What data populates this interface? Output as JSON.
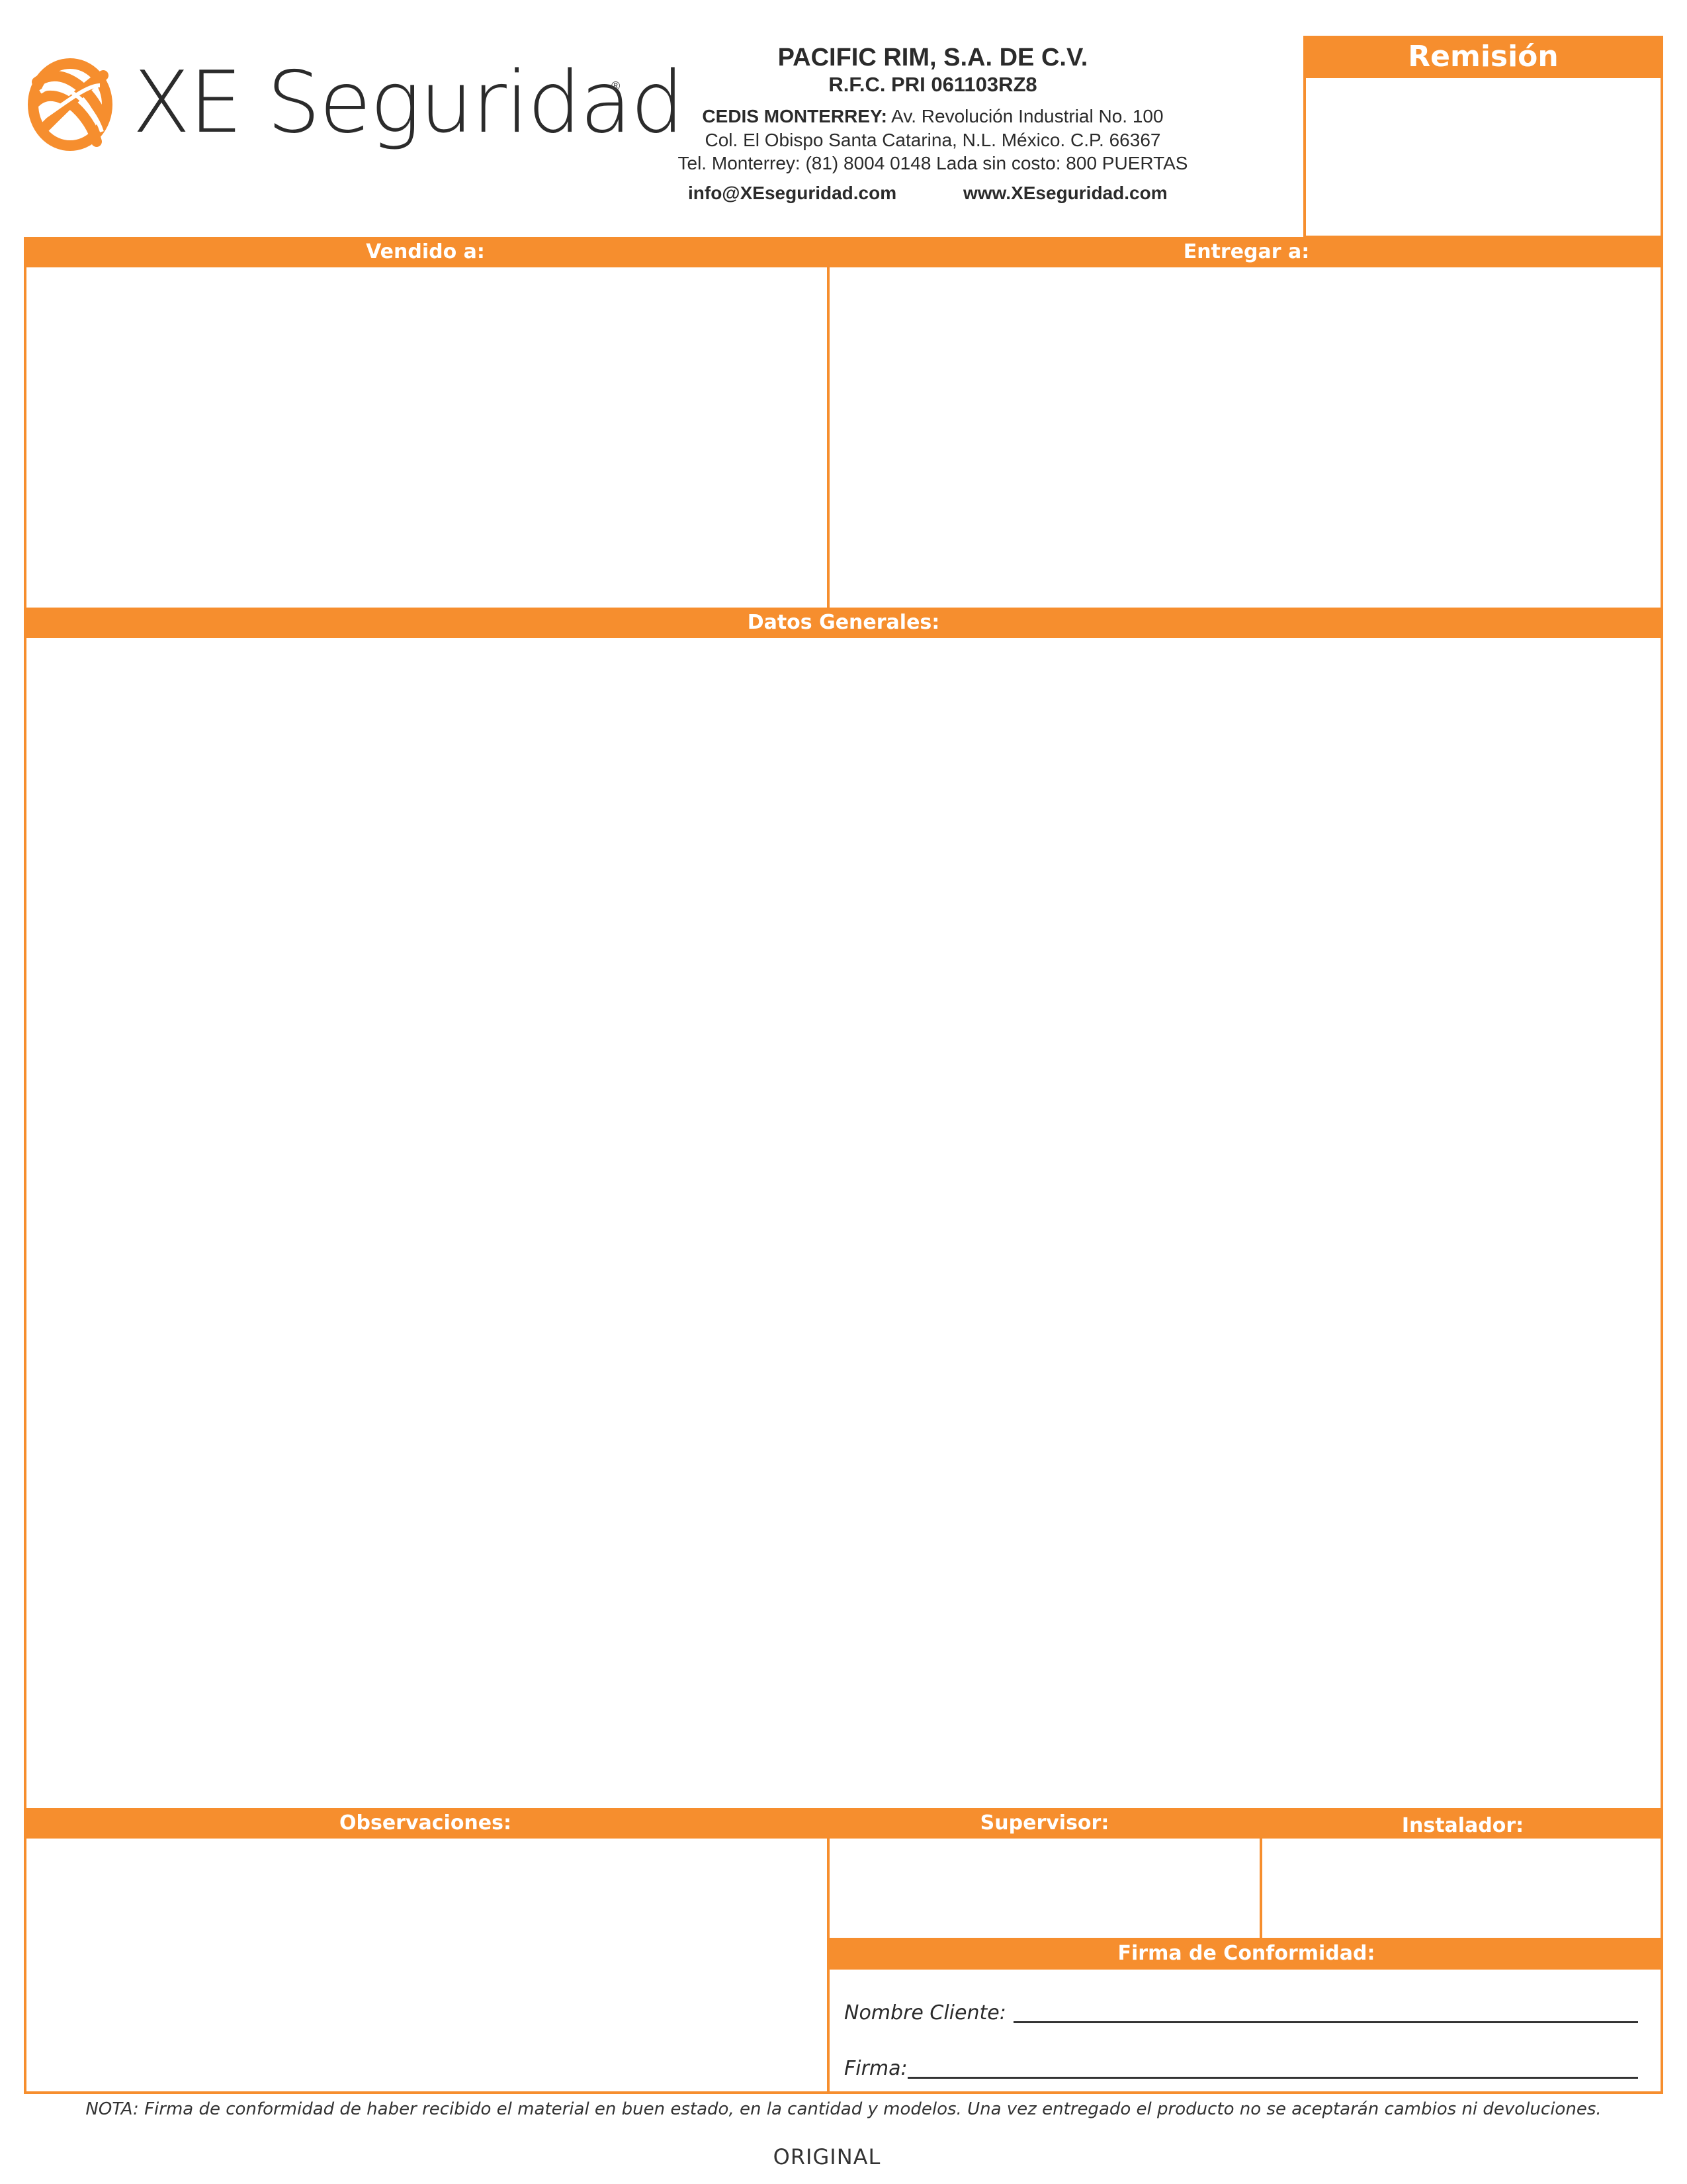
{
  "brand": {
    "name": "XE Seguridad",
    "registered_mark": "®",
    "accent_color": "#F68E2E",
    "logo_icon": "xe-globe-logo-icon"
  },
  "company": {
    "name": "PACIFIC RIM, S.A. DE C.V.",
    "rfc": "R.F.C. PRI 061103RZ8",
    "address_label": "CEDIS MONTERREY:",
    "address_line1": "Av. Revolución Industrial No. 100",
    "address_line2": "Col. El Obispo Santa Catarina, N.L. México. C.P. 66367",
    "phone_line": "Tel. Monterrey: (81) 8004 0148   Lada sin costo: 800 PUERTAS",
    "email": "info@XEseguridad.com",
    "website": "www.XEseguridad.com"
  },
  "document": {
    "title": "Remisión",
    "folio": ""
  },
  "sections": {
    "vendido": "Vendido a:",
    "entregar": "Entregar a:",
    "datos_generales": "Datos Generales:",
    "observaciones": "Observaciones:",
    "supervisor": "Supervisor:",
    "instalador": "Instalador:",
    "firma_conformidad": "Firma de Conformidad:"
  },
  "signature": {
    "nombre_label": "Nombre Cliente:",
    "firma_label": "Firma:"
  },
  "footer": {
    "nota": "NOTA: Firma de conformidad de haber recibido el material en buen estado, en la cantidad y modelos. Una vez entregado el producto no se aceptarán cambios ni devoluciones.",
    "copy_label": "ORIGINAL"
  }
}
